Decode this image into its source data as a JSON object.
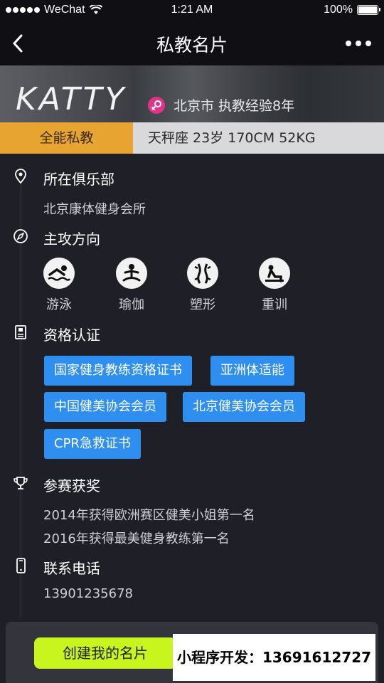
{
  "status_bar": {
    "carrier": "WeChat",
    "time": "1:21 AM",
    "battery": "100%"
  },
  "nav": {
    "title": "私教名片"
  },
  "profile": {
    "name": "KATTY",
    "location_experience": "北京市  执教经验8年",
    "role": "全能私教",
    "attributes": "天秤座  23岁  170CM  52KG"
  },
  "sections": {
    "club": {
      "title": "所在俱乐部",
      "value": "北京康体健身会所"
    },
    "specialty": {
      "title": "主攻方向",
      "items": [
        {
          "label": "游泳",
          "icon": "swim-icon"
        },
        {
          "label": "瑜伽",
          "icon": "yoga-icon"
        },
        {
          "label": "塑形",
          "icon": "body-shaping-icon"
        },
        {
          "label": "重训",
          "icon": "weight-training-icon"
        }
      ]
    },
    "certifications": {
      "title": "资格认证",
      "items": [
        "国家健身教练资格证书",
        "亚洲体适能",
        "中国健美协会会员",
        "北京健美协会会员",
        "CPR急救证书"
      ]
    },
    "awards": {
      "title": "参赛获奖",
      "items": [
        "2014年获得欧洲赛区健美小姐第一名",
        "2016年获得最美健身教练第一名"
      ]
    },
    "contact": {
      "title": "联系电话",
      "phone": "13901235678"
    }
  },
  "footer": {
    "create_button": "创建我的名片",
    "developer_note": "小程序开发：13691612727"
  },
  "colors": {
    "background": "#1f1f27",
    "role_tag": "#e8a431",
    "badge": "#2e8ff0",
    "button": "#c8f51d"
  }
}
